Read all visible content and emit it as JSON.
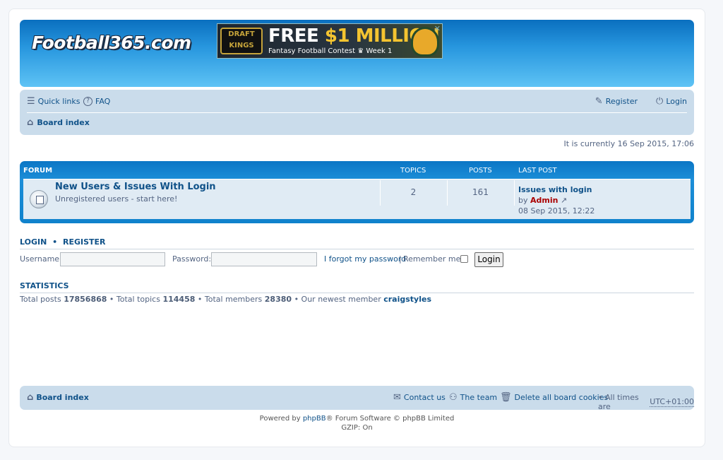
{
  "header": {
    "logo_text": "Football365.com",
    "ad": {
      "brand": "DRAFT KINGS",
      "headline_a": "FREE ",
      "headline_b": "$1 MILLION",
      "subline": "Fantasy Football Contest ♛ Week 1",
      "close": "✕"
    }
  },
  "navbar": {
    "quick_links": "Quick links",
    "faq": "FAQ",
    "register": "Register",
    "login": "Login",
    "board_index": "Board index"
  },
  "current_time": "It is currently 16 Sep 2015, 17:06",
  "forum_table": {
    "headers": {
      "forum": "FORUM",
      "topics": "TOPICS",
      "posts": "POSTS",
      "last_post": "LAST POST"
    },
    "rows": [
      {
        "title": "New Users & Issues With Login",
        "description": "Unregistered users - start here!",
        "topics": "2",
        "posts": "161",
        "last_post_title": "Issues with login",
        "last_post_by": "by",
        "last_post_author": "Admin",
        "last_post_date": "08 Sep 2015, 12:22"
      }
    ]
  },
  "login_section": {
    "title_login": "LOGIN",
    "bullet": "•",
    "title_register": "REGISTER",
    "username_label": "Username:",
    "username_value": "",
    "password_label": "Password:",
    "password_value": "",
    "forgot_password": "I forgot my password",
    "divider": "|",
    "remember_me": "Remember me",
    "login_button": "Login"
  },
  "statistics": {
    "title": "STATISTICS",
    "total_posts_label": "Total posts",
    "total_posts": "17856868",
    "total_topics_label": "• Total topics",
    "total_topics": "114458",
    "total_members_label": "• Total members",
    "total_members": "28380",
    "newest_label": "• Our newest member",
    "newest_member": "craigstyles"
  },
  "footer": {
    "board_index": "Board index",
    "contact_us": "Contact us",
    "the_team": "The team",
    "delete_cookies": "Delete all board cookies",
    "times_prefix": "• All times are",
    "timezone": "UTC+01:00"
  },
  "copyright": {
    "powered_by": "Powered by",
    "phpbb": "phpBB",
    "rest": "® Forum Software © phpBB Limited",
    "gzip": "GZIP: On"
  }
}
